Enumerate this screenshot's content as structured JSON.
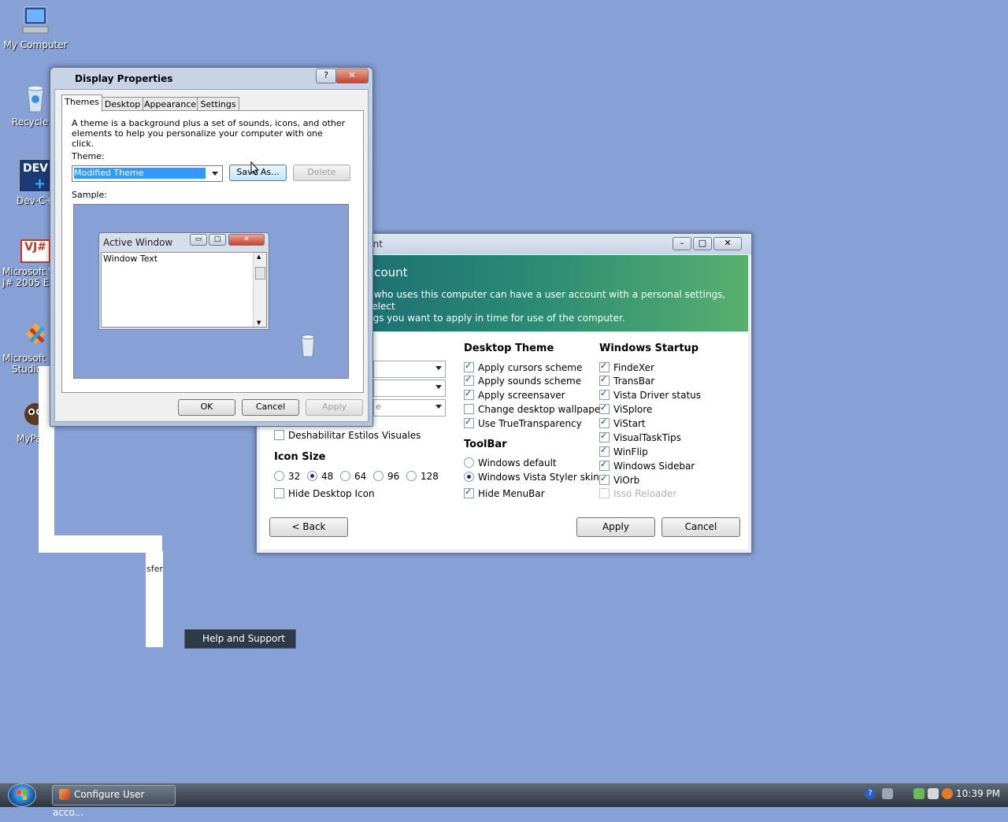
{
  "desktop": {
    "icons": [
      {
        "name": "my-computer-icon",
        "label": "My Computer"
      },
      {
        "name": "recycle-bin-icon",
        "label": "Recycle B"
      },
      {
        "name": "dev-cpp-icon",
        "label": "Dev-C++",
        "glyph_text": "DEV"
      },
      {
        "name": "vjsharp-icon",
        "label1": "Microsoft Vi",
        "label2": "J# 2005 Expr",
        "glyph_text": "VJ#"
      },
      {
        "name": "visual-studio-icon",
        "label1": "Microsoft",
        "label2": "Studio"
      },
      {
        "name": "mypal-icon",
        "label": "MyPa"
      }
    ],
    "start_menu_fragment": {
      "partial_text": "sfer",
      "help_item": "Help and Support"
    }
  },
  "display_properties": {
    "title": "Display Properties",
    "help_glyph": "?",
    "close_glyph": "✕",
    "tabs": [
      {
        "label": "Themes",
        "active": true
      },
      {
        "label": "Desktop"
      },
      {
        "label": "Appearance"
      },
      {
        "label": "Settings"
      }
    ],
    "description": "A theme is a background plus a set of sounds, icons, and other elements to help you personalize your computer with one click.",
    "theme_label": "Theme:",
    "theme_value": "Modified Theme",
    "save_as": "Save As...",
    "delete": "Delete",
    "sample_label": "Sample:",
    "sample_window": {
      "title": "Active Window",
      "text": "Window Text",
      "scroll_up": "▲",
      "scroll_down": "▼",
      "min": "▭",
      "max": "□",
      "close": "✕"
    },
    "ok": "OK",
    "cancel": "Cancel",
    "apply": "Apply"
  },
  "user_account": {
    "title_partial": "unt",
    "banner_heading": "ccount",
    "banner_text": "r who uses this computer can have a user account with a personal settings, select\nngs you want to apply in time for use of the computer.",
    "combo_partial": "e",
    "deshabilitar": "Deshabilitar Estilos Visuales",
    "icon_size": {
      "heading": "Icon Size",
      "options": [
        "32",
        "48",
        "64",
        "96",
        "128"
      ],
      "selected": "48"
    },
    "hide_desktop_icon": "Hide Desktop Icon",
    "desktop_theme": {
      "heading": "Desktop Theme",
      "items": [
        {
          "label": "Apply cursors scheme",
          "checked": true
        },
        {
          "label": "Apply sounds scheme",
          "checked": true
        },
        {
          "label": "Apply screensaver",
          "checked": true
        },
        {
          "label": "Change desktop wallpaper",
          "checked": false
        },
        {
          "label": "Use TrueTransparency",
          "checked": true
        }
      ]
    },
    "toolbar": {
      "heading": "ToolBar",
      "options": [
        {
          "label": "Windows default",
          "selected": false
        },
        {
          "label": "Windows Vista Styler skin",
          "selected": true
        }
      ],
      "hide_menubar": "Hide MenuBar"
    },
    "windows_startup": {
      "heading": "Windows Startup",
      "items": [
        {
          "label": "FindeXer",
          "checked": true
        },
        {
          "label": "TransBar",
          "checked": true
        },
        {
          "label": "Vista Driver status",
          "checked": true
        },
        {
          "label": "ViSplore",
          "checked": true
        },
        {
          "label": "ViStart",
          "checked": true
        },
        {
          "label": "VisualTaskTips",
          "checked": true
        },
        {
          "label": "WinFlip",
          "checked": true
        },
        {
          "label": "Windows Sidebar",
          "checked": true
        },
        {
          "label": "ViOrb",
          "checked": true
        },
        {
          "label": "Isso Reloader",
          "checked": false,
          "disabled": true
        }
      ]
    },
    "back": "< Back",
    "apply": "Apply",
    "cancel": "Cancel"
  },
  "taskbar": {
    "item": "Configure User acco...",
    "clock": "10:39 PM",
    "tray_icons": [
      "help-icon",
      "network-icon",
      "volume-icon",
      "language-icon",
      "search-icon"
    ]
  },
  "colors": {
    "desktop": "#87a0d6",
    "banner_start": "#185f73",
    "banner_end": "#58b06e",
    "selection": "#3399ff"
  }
}
